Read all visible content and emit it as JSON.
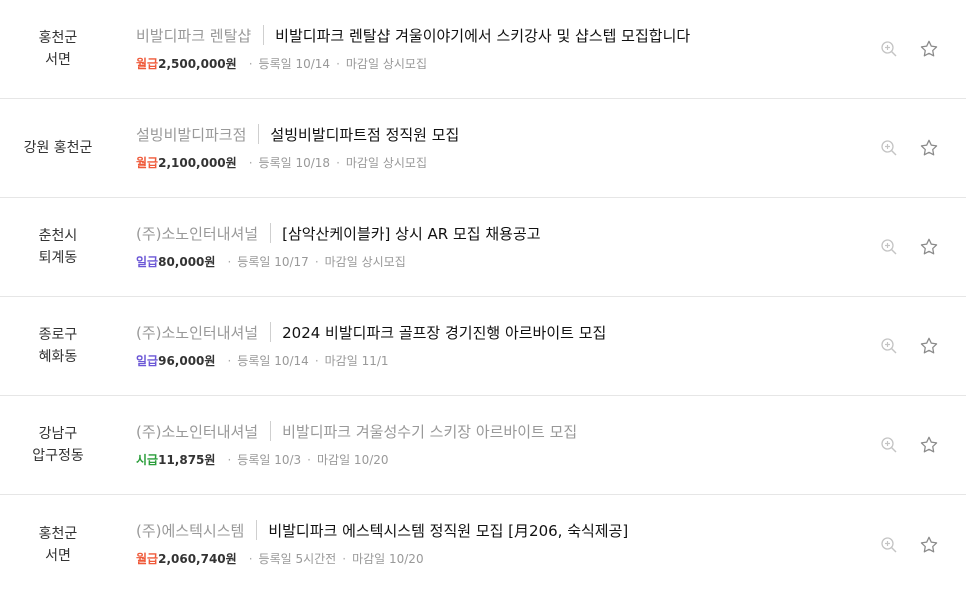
{
  "colors": {
    "monthly": "#ef5a3a",
    "daily": "#6b57d6",
    "hourly": "#2a9d3a"
  },
  "listings": [
    {
      "location": [
        "홍천군",
        "서면"
      ],
      "company": "비발디파크 렌탈샵",
      "title": "비발디파크 렌탈샵 겨울이야기에서 스키강사 및 샵스텝 모집합니다",
      "pay_type": "월급",
      "pay_type_color": "monthly",
      "pay_amount": "2,500,000원",
      "registered": "등록일 10/14",
      "deadline": "마감일 상시모집",
      "icons": [
        "zoom-in-icon",
        "star-icon"
      ]
    },
    {
      "location": [
        "강원 홍천군"
      ],
      "company": "설빙비발디파크점",
      "title": "설빙비발디파트점 정직원 모집",
      "pay_type": "월급",
      "pay_type_color": "monthly",
      "pay_amount": "2,100,000원",
      "registered": "등록일 10/18",
      "deadline": "마감일 상시모집",
      "icons": [
        "zoom-in-icon",
        "star-icon"
      ]
    },
    {
      "location": [
        "춘천시",
        "퇴계동"
      ],
      "company": "(주)소노인터내셔널",
      "title": "[삼악산케이블카] 상시 AR 모집 채용공고",
      "pay_type": "일급",
      "pay_type_color": "daily",
      "pay_amount": "80,000원",
      "registered": "등록일 10/17",
      "deadline": "마감일 상시모집",
      "icons": [
        "zoom-in-icon",
        "star-icon"
      ]
    },
    {
      "location": [
        "종로구",
        "혜화동"
      ],
      "company": "(주)소노인터내셔널",
      "title": "2024 비발디파크 골프장 경기진행 아르바이트 모집",
      "pay_type": "일급",
      "pay_type_color": "daily",
      "pay_amount": "96,000원",
      "registered": "등록일 10/14",
      "deadline": "마감일 11/1",
      "icons": [
        "zoom-in-icon",
        "star-icon"
      ]
    },
    {
      "location": [
        "강남구",
        "압구정동"
      ],
      "company": "(주)소노인터내셔널",
      "title": "비발디파크 겨울성수기 스키장 아르바이트 모집",
      "title_muted": true,
      "pay_type": "시급",
      "pay_type_color": "hourly",
      "pay_amount": "11,875원",
      "registered": "등록일 10/3",
      "deadline": "마감일 10/20",
      "icons": [
        "zoom-in-icon",
        "star-icon"
      ]
    },
    {
      "location": [
        "홍천군",
        "서면"
      ],
      "company": "(주)에스텍시스템",
      "title": "비발디파크 에스텍시스템 정직원 모집 [月206, 숙식제공]",
      "pay_type": "월급",
      "pay_type_color": "monthly",
      "pay_amount": "2,060,740원",
      "registered": "등록일 5시간전",
      "deadline": "마감일 10/20",
      "icons": [
        "zoom-in-icon",
        "star-icon"
      ]
    }
  ]
}
